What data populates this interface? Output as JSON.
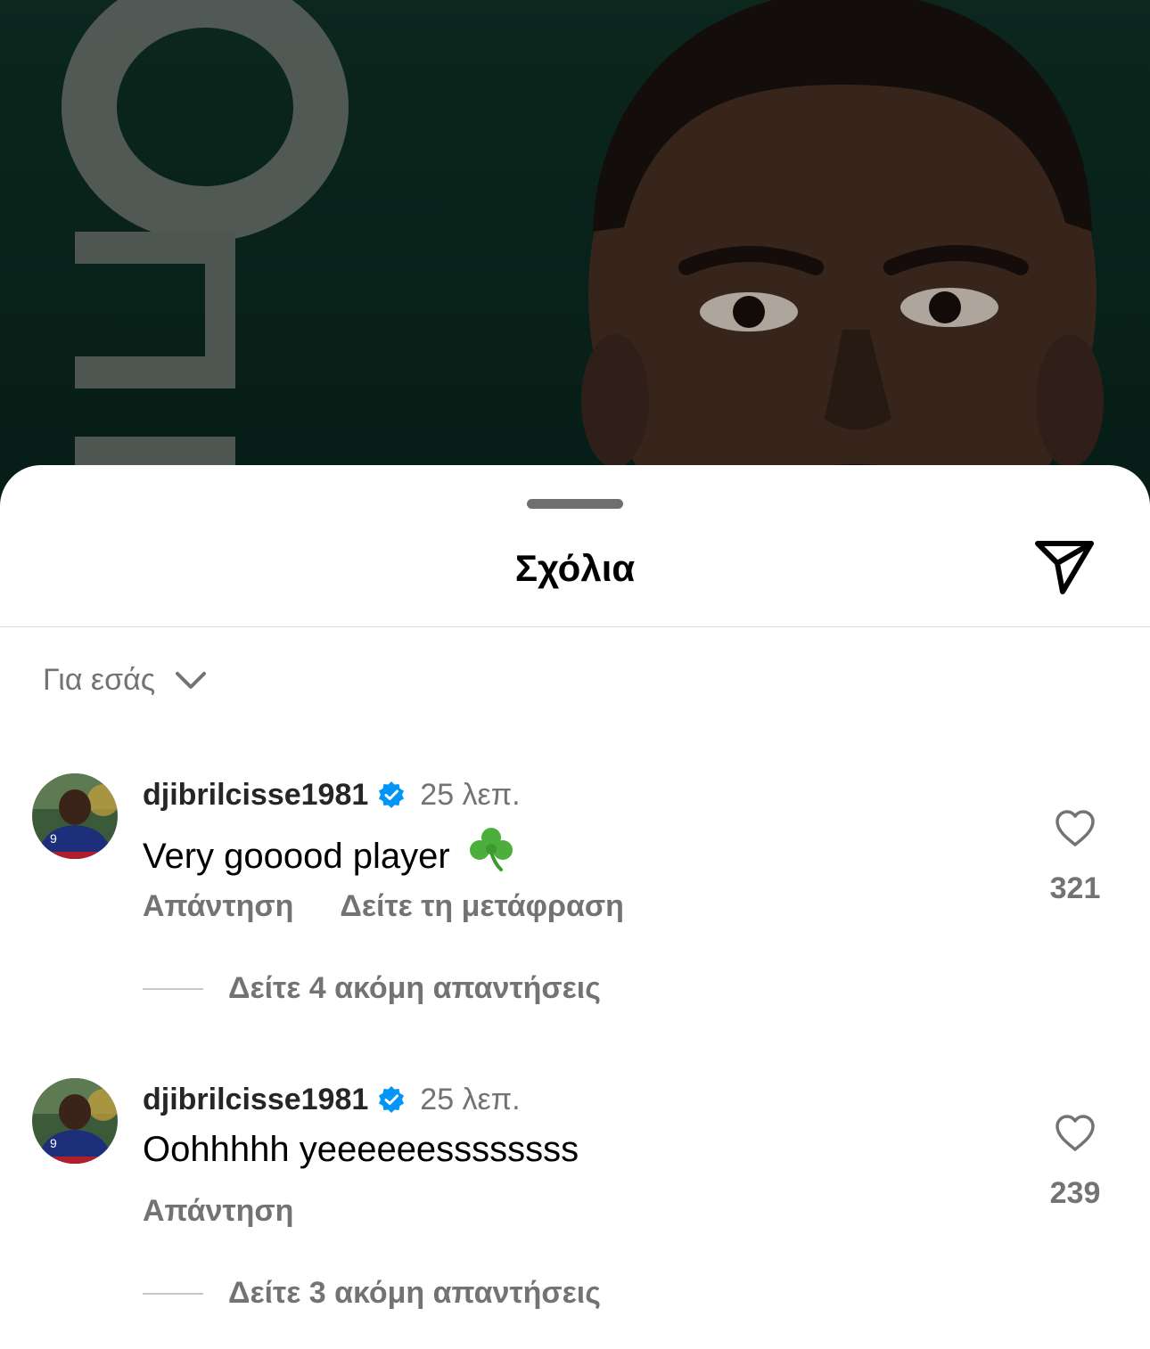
{
  "sheet": {
    "title": "Σχόλια"
  },
  "sort": {
    "label": "Για εσάς"
  },
  "comments": [
    {
      "username": "djibrilcisse1981",
      "verified": true,
      "time": "25 λεπ.",
      "text": "Very gooood player",
      "emoji": "shamrock-icon",
      "reply_label": "Απάντηση",
      "translate_label": "Δείτε τη μετάφραση",
      "more_replies": "Δείτε 4 ακόμη απαντήσεις",
      "likes": "321"
    },
    {
      "username": "djibrilcisse1981",
      "verified": true,
      "time": "25 λεπ.",
      "text": "Oohhhhh yeeeeeessssssss",
      "reply_label": "Απάντηση",
      "more_replies": "Δείτε 3 ακόμη απαντήσεις",
      "likes": "239"
    }
  ],
  "colors": {
    "verified_badge": "#0095f6",
    "secondary_text": "#737373",
    "background_post": "#0e2a22"
  }
}
